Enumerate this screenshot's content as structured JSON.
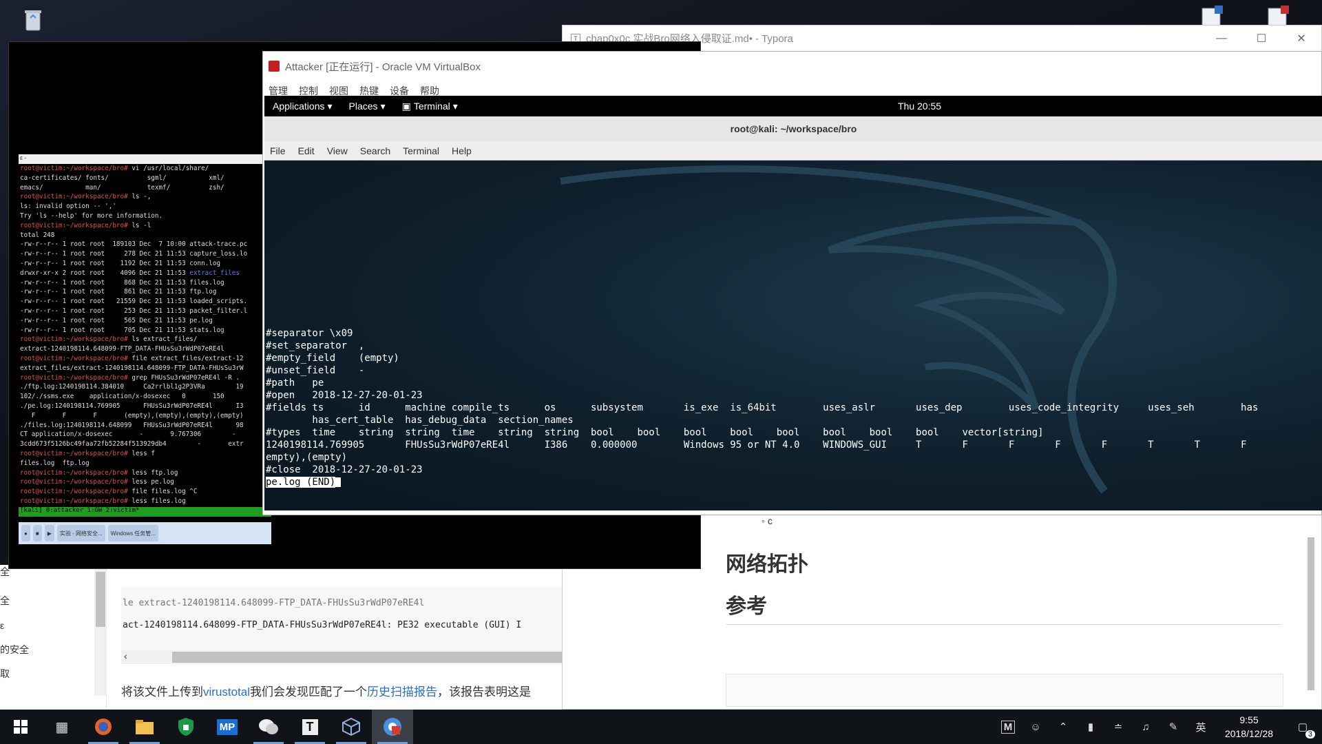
{
  "typora": {
    "title": "chap0x0c 实战Bro网络入侵取证.md• - Typora",
    "icon_letter": "T",
    "bullet": "c",
    "heading1": "网络拓扑",
    "heading2": "参考"
  },
  "leftdoc": {
    "side_items": [
      "全",
      "全",
      "ε",
      "的安全",
      "取"
    ],
    "code_line1": "le extract-1240198114.648099-FTP_DATA-FHUsSu3rWdP07eRE4l",
    "code_line2": "act-1240198114.648099-FTP_DATA-FHUsSu3rWdP07eRE4l: PE32 executable (GUI) I",
    "para_prefix": "将该文件上传到",
    "para_link1": "virustotal",
    "para_mid": "我们会发现匹配了一个",
    "para_link2": "历史扫描报告",
    "para_suffix": "，该报告表明这是"
  },
  "virtualbox": {
    "title": "Attacker [正在运行] - Oracle VM VirtualBox",
    "menu": [
      "管理",
      "控制",
      "视图",
      "热键",
      "设备",
      "帮助"
    ]
  },
  "gnome": {
    "applications": "Applications",
    "places": "Places",
    "terminal": "Terminal",
    "clock": "Thu 20:55"
  },
  "terminal": {
    "title": "root@kali: ~/workspace/bro",
    "menu": [
      "File",
      "Edit",
      "View",
      "Search",
      "Terminal",
      "Help"
    ],
    "lines": [
      "#separator \\x09",
      "#set_separator  ,",
      "#empty_field    (empty)",
      "#unset_field    -",
      "#path   pe",
      "#open   2018-12-27-20-01-23",
      "#fields ts      id      machine compile_ts      os      subsystem       is_exe  is_64bit        uses_aslr       uses_dep        uses_code_integrity     uses_seh        has",
      "        has_cert_table  has_debug_data  section_names",
      "#types  time    string  string  time    string  string  bool    bool    bool    bool    bool    bool    bool    bool    vector[string]",
      "1240198114.769905       FHUsSu3rWdP07eRE4l      I386    0.000000        Windows 95 or NT 4.0    WINDOWS_GUI     T       F       F       F       F       T       T       F",
      "empty),(empty)",
      "#close  2018-12-27-20-01-23"
    ],
    "end_label": "pe.log (END)"
  },
  "tmux": {
    "titlebar": "ε -",
    "status": "[kali] 0:attacker  1:GW  2:victim*",
    "lines": [
      [
        "u",
        "root@victim:~/workspace/bro# ",
        "vi /usr/local/share/"
      ],
      [
        "t",
        "ca-certificates/ fonts/          sgml/           xml/"
      ],
      [
        "t",
        "emacs/           man/            texmf/          zsh/"
      ],
      [
        "u",
        "root@victim:~/workspace/bro# ",
        "ls -,"
      ],
      [
        "t",
        "ls: invalid option -- ','"
      ],
      [
        "t",
        "Try 'ls --help' for more information."
      ],
      [
        "u",
        "root@victim:~/workspace/bro# ",
        "ls -l"
      ],
      [
        "t",
        "total 248"
      ],
      [
        "t",
        "-rw-r--r-- 1 root root  189103 Dec  7 10:00 attack-trace.pc"
      ],
      [
        "t",
        "-rw-r--r-- 1 root root     278 Dec 21 11:53 capture_loss.lo"
      ],
      [
        "t",
        "-rw-r--r-- 1 root root    1192 Dec 21 11:53 conn.log"
      ],
      [
        "d",
        "drwxr-xr-x 2 root root    4096 Dec 21 11:53 ",
        "extract_files"
      ],
      [
        "t",
        "-rw-r--r-- 1 root root     868 Dec 21 11:53 files.log"
      ],
      [
        "t",
        "-rw-r--r-- 1 root root     861 Dec 21 11:53 ftp.log"
      ],
      [
        "t",
        "-rw-r--r-- 1 root root   21559 Dec 21 11:53 loaded_scripts."
      ],
      [
        "t",
        "-rw-r--r-- 1 root root     253 Dec 21 11:53 packet_filter.l"
      ],
      [
        "t",
        "-rw-r--r-- 1 root root     565 Dec 21 11:53 pe.log"
      ],
      [
        "t",
        "-rw-r--r-- 1 root root     705 Dec 21 11:53 stats.log"
      ],
      [
        "u",
        "root@victim:~/workspace/bro# ",
        "ls extract_files/"
      ],
      [
        "t",
        "extract-1240198114.648099-FTP_DATA-FHUsSu3rWdP07eRE4l"
      ],
      [
        "u",
        "root@victim:~/workspace/bro# ",
        "file extract_files/extract-12"
      ],
      [
        "t",
        "extract_files/extract-1240198114.648099-FTP_DATA-FHUsSu3rW"
      ],
      [
        "u",
        "root@victim:~/workspace/bro# ",
        "grep FHUsSu3rWdP07eRE4l -R ."
      ],
      [
        "t",
        "./ftp.log:1240198114.384010     Ca2rrlbl1g2P3VRa        19"
      ],
      [
        "t",
        "102/./ssms.exe    application/x-dosexec   0       150"
      ],
      [
        "t",
        "./pe.log:1240198114.769905      FHUsSu3rWdP07eRE4l      I3"
      ],
      [
        "t",
        "   F       F       F       (empty),(empty),(empty),(empty)"
      ],
      [
        "t",
        "./files.log:1240198114.648099   FHUsSu3rWdP07eRE4l      98"
      ],
      [
        "t",
        "CT application/x-dosexec       -       9.767306        -"
      ],
      [
        "t",
        "3cdd673f5126bc49faa72fb52284f513929db4        -       extr"
      ],
      [
        "u",
        "root@victim:~/workspace/bro# ",
        "less f"
      ],
      [
        "t",
        "files.log  ftp.log"
      ],
      [
        "u",
        "root@victim:~/workspace/bro# ",
        "less ftp.log"
      ],
      [
        "u",
        "root@victim:~/workspace/bro# ",
        "less pe.log"
      ],
      [
        "u",
        "root@victim:~/workspace/bro# ",
        "file files.log ^C"
      ],
      [
        "u",
        "root@victim:~/workspace/bro# ",
        "less files.log "
      ]
    ],
    "win_tasks": [
      "实验 - 网络安全...",
      "Windows 任务管..."
    ]
  },
  "taskbar": {
    "items": [
      "windows-start",
      "task-view",
      "firefox",
      "file-explorer",
      "shield",
      "MP",
      "wechat",
      "typora",
      "virtualbox",
      "chrome-like"
    ],
    "mp_label": "MP",
    "typora_label": "T",
    "ime": "英",
    "time": "9:55",
    "date": "2018/12/28",
    "notif_count": "3",
    "m_label": "M"
  }
}
